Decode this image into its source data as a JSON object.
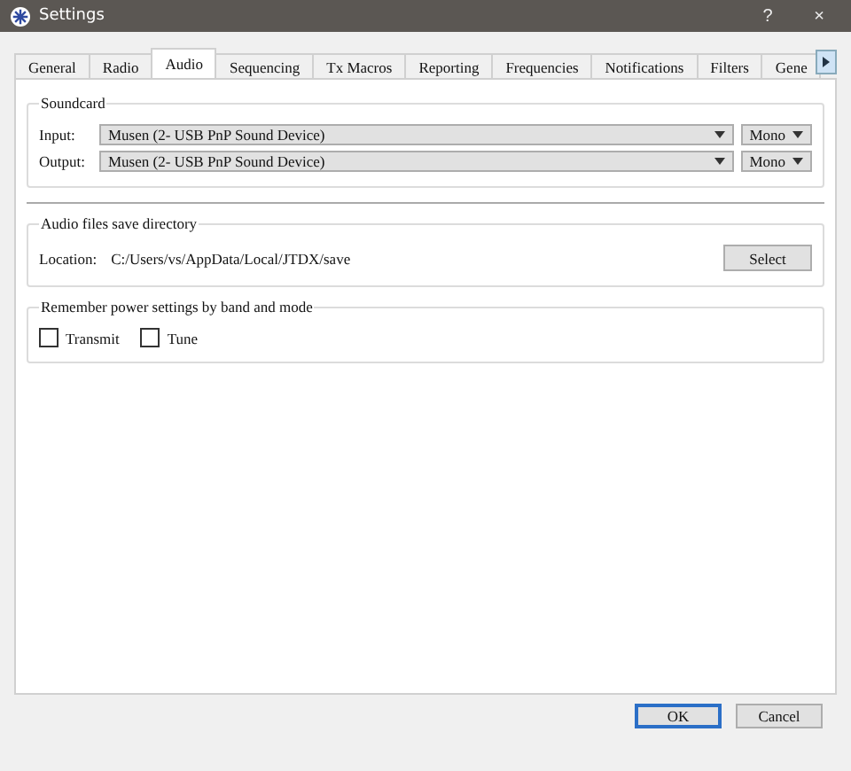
{
  "window": {
    "title": "Settings",
    "help": "?",
    "close": "×"
  },
  "tabs": [
    {
      "label": "General",
      "selected": false
    },
    {
      "label": "Radio",
      "selected": false
    },
    {
      "label": "Audio",
      "selected": true
    },
    {
      "label": "Sequencing",
      "selected": false
    },
    {
      "label": "Tx Macros",
      "selected": false
    },
    {
      "label": "Reporting",
      "selected": false
    },
    {
      "label": "Frequencies",
      "selected": false
    },
    {
      "label": "Notifications",
      "selected": false
    },
    {
      "label": "Filters",
      "selected": false
    },
    {
      "label": "Gene",
      "selected": false
    }
  ],
  "soundcard": {
    "title": "Soundcard",
    "rows": [
      {
        "label": "Input:",
        "device": "Musen (2- USB PnP Sound Device)",
        "channel": "Mono"
      },
      {
        "label": "Output:",
        "device": "Musen (2- USB PnP Sound Device)",
        "channel": "Mono"
      }
    ]
  },
  "save_directory": {
    "title": "Audio files save directory",
    "label": "Location:",
    "path": "C:/Users/vs/AppData/Local/JTDX/save",
    "button": "Select"
  },
  "power": {
    "title": "Remember power settings by band and mode",
    "options": [
      {
        "label": "Transmit",
        "checked": false
      },
      {
        "label": "Tune",
        "checked": false
      }
    ]
  },
  "buttons": [
    {
      "label": "OK",
      "default": true
    },
    {
      "label": "Cancel",
      "default": false
    }
  ]
}
